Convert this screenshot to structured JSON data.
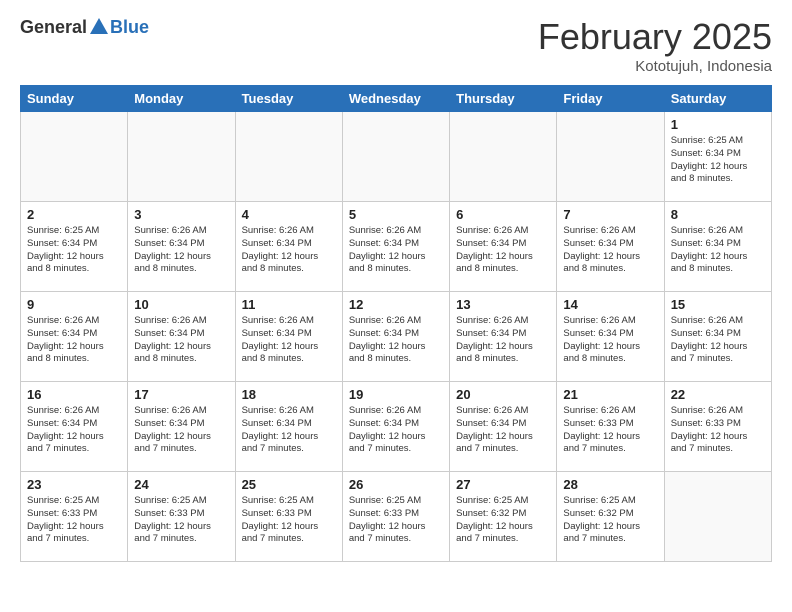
{
  "header": {
    "logo_general": "General",
    "logo_blue": "Blue",
    "title": "February 2025",
    "subtitle": "Kototujuh, Indonesia"
  },
  "weekdays": [
    "Sunday",
    "Monday",
    "Tuesday",
    "Wednesday",
    "Thursday",
    "Friday",
    "Saturday"
  ],
  "weeks": [
    [
      {
        "day": "",
        "info": ""
      },
      {
        "day": "",
        "info": ""
      },
      {
        "day": "",
        "info": ""
      },
      {
        "day": "",
        "info": ""
      },
      {
        "day": "",
        "info": ""
      },
      {
        "day": "",
        "info": ""
      },
      {
        "day": "1",
        "info": "Sunrise: 6:25 AM\nSunset: 6:34 PM\nDaylight: 12 hours\nand 8 minutes."
      }
    ],
    [
      {
        "day": "2",
        "info": "Sunrise: 6:25 AM\nSunset: 6:34 PM\nDaylight: 12 hours\nand 8 minutes."
      },
      {
        "day": "3",
        "info": "Sunrise: 6:26 AM\nSunset: 6:34 PM\nDaylight: 12 hours\nand 8 minutes."
      },
      {
        "day": "4",
        "info": "Sunrise: 6:26 AM\nSunset: 6:34 PM\nDaylight: 12 hours\nand 8 minutes."
      },
      {
        "day": "5",
        "info": "Sunrise: 6:26 AM\nSunset: 6:34 PM\nDaylight: 12 hours\nand 8 minutes."
      },
      {
        "day": "6",
        "info": "Sunrise: 6:26 AM\nSunset: 6:34 PM\nDaylight: 12 hours\nand 8 minutes."
      },
      {
        "day": "7",
        "info": "Sunrise: 6:26 AM\nSunset: 6:34 PM\nDaylight: 12 hours\nand 8 minutes."
      },
      {
        "day": "8",
        "info": "Sunrise: 6:26 AM\nSunset: 6:34 PM\nDaylight: 12 hours\nand 8 minutes."
      }
    ],
    [
      {
        "day": "9",
        "info": "Sunrise: 6:26 AM\nSunset: 6:34 PM\nDaylight: 12 hours\nand 8 minutes."
      },
      {
        "day": "10",
        "info": "Sunrise: 6:26 AM\nSunset: 6:34 PM\nDaylight: 12 hours\nand 8 minutes."
      },
      {
        "day": "11",
        "info": "Sunrise: 6:26 AM\nSunset: 6:34 PM\nDaylight: 12 hours\nand 8 minutes."
      },
      {
        "day": "12",
        "info": "Sunrise: 6:26 AM\nSunset: 6:34 PM\nDaylight: 12 hours\nand 8 minutes."
      },
      {
        "day": "13",
        "info": "Sunrise: 6:26 AM\nSunset: 6:34 PM\nDaylight: 12 hours\nand 8 minutes."
      },
      {
        "day": "14",
        "info": "Sunrise: 6:26 AM\nSunset: 6:34 PM\nDaylight: 12 hours\nand 8 minutes."
      },
      {
        "day": "15",
        "info": "Sunrise: 6:26 AM\nSunset: 6:34 PM\nDaylight: 12 hours\nand 7 minutes."
      }
    ],
    [
      {
        "day": "16",
        "info": "Sunrise: 6:26 AM\nSunset: 6:34 PM\nDaylight: 12 hours\nand 7 minutes."
      },
      {
        "day": "17",
        "info": "Sunrise: 6:26 AM\nSunset: 6:34 PM\nDaylight: 12 hours\nand 7 minutes."
      },
      {
        "day": "18",
        "info": "Sunrise: 6:26 AM\nSunset: 6:34 PM\nDaylight: 12 hours\nand 7 minutes."
      },
      {
        "day": "19",
        "info": "Sunrise: 6:26 AM\nSunset: 6:34 PM\nDaylight: 12 hours\nand 7 minutes."
      },
      {
        "day": "20",
        "info": "Sunrise: 6:26 AM\nSunset: 6:34 PM\nDaylight: 12 hours\nand 7 minutes."
      },
      {
        "day": "21",
        "info": "Sunrise: 6:26 AM\nSunset: 6:33 PM\nDaylight: 12 hours\nand 7 minutes."
      },
      {
        "day": "22",
        "info": "Sunrise: 6:26 AM\nSunset: 6:33 PM\nDaylight: 12 hours\nand 7 minutes."
      }
    ],
    [
      {
        "day": "23",
        "info": "Sunrise: 6:25 AM\nSunset: 6:33 PM\nDaylight: 12 hours\nand 7 minutes."
      },
      {
        "day": "24",
        "info": "Sunrise: 6:25 AM\nSunset: 6:33 PM\nDaylight: 12 hours\nand 7 minutes."
      },
      {
        "day": "25",
        "info": "Sunrise: 6:25 AM\nSunset: 6:33 PM\nDaylight: 12 hours\nand 7 minutes."
      },
      {
        "day": "26",
        "info": "Sunrise: 6:25 AM\nSunset: 6:33 PM\nDaylight: 12 hours\nand 7 minutes."
      },
      {
        "day": "27",
        "info": "Sunrise: 6:25 AM\nSunset: 6:32 PM\nDaylight: 12 hours\nand 7 minutes."
      },
      {
        "day": "28",
        "info": "Sunrise: 6:25 AM\nSunset: 6:32 PM\nDaylight: 12 hours\nand 7 minutes."
      },
      {
        "day": "",
        "info": ""
      }
    ]
  ]
}
